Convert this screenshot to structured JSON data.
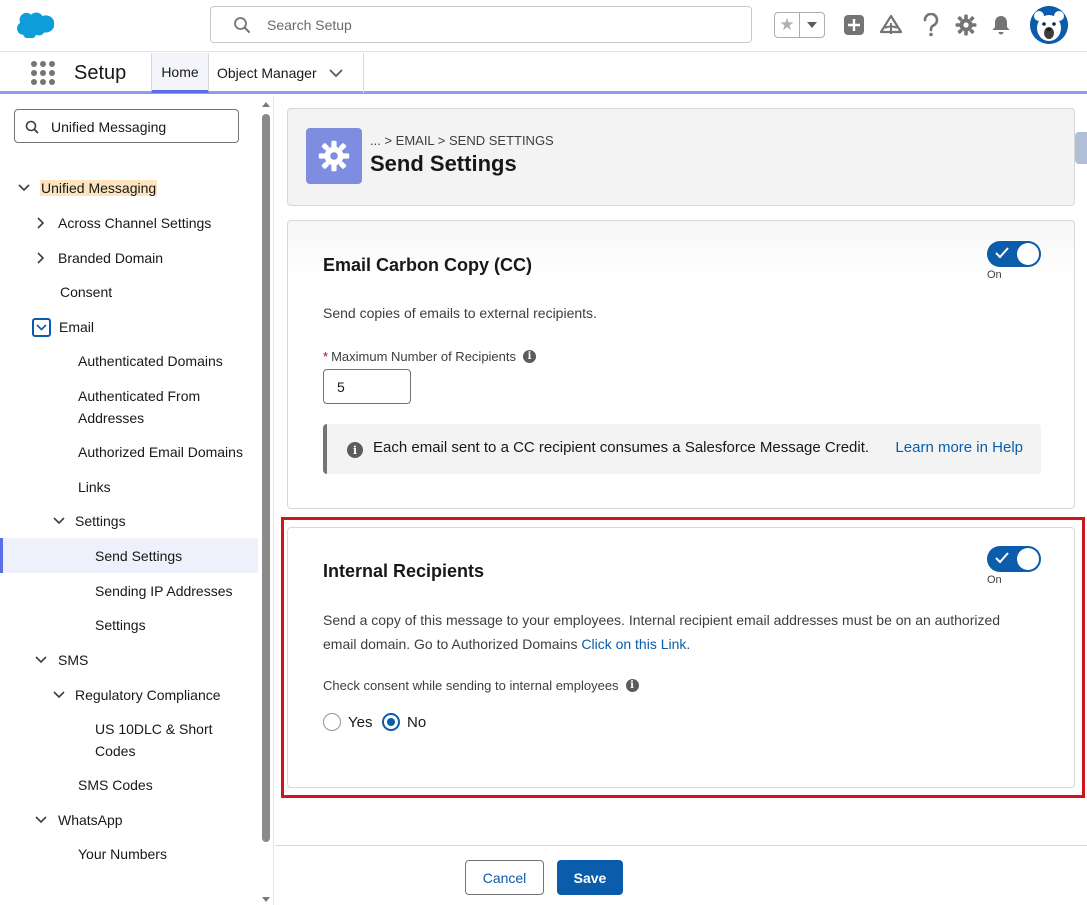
{
  "header": {
    "search_placeholder": "Search Setup",
    "icons": [
      "salesforce-logo",
      "search-icon",
      "star-icon",
      "chevron-down-icon",
      "add-icon",
      "trailhead-icon",
      "help-icon",
      "gear-icon",
      "bell-icon",
      "avatar"
    ]
  },
  "context_bar": {
    "app_name": "Setup",
    "tabs": [
      {
        "label": "Home"
      },
      {
        "label": "Object Manager"
      }
    ]
  },
  "left_nav": {
    "quickfind_value": "Unified Messaging",
    "items": [
      {
        "label": "Unified Messaging"
      },
      {
        "label": "Across Channel Settings"
      },
      {
        "label": "Branded Domain"
      },
      {
        "label": "Consent"
      },
      {
        "label": "Email"
      },
      {
        "label": "Authenticated Domains"
      },
      {
        "label": "Authenticated From"
      },
      {
        "label": "Addresses"
      },
      {
        "label": "Authorized Email Domains"
      },
      {
        "label": "Links"
      },
      {
        "label": "Settings"
      },
      {
        "label": "Send Settings"
      },
      {
        "label": "Sending IP Addresses"
      },
      {
        "label": "Settings"
      },
      {
        "label": "SMS"
      },
      {
        "label": "Regulatory Compliance"
      },
      {
        "label": "US 10DLC & Short"
      },
      {
        "label": "Codes"
      },
      {
        "label": "SMS Codes"
      },
      {
        "label": "WhatsApp"
      },
      {
        "label": "Your Numbers"
      }
    ]
  },
  "page_header": {
    "breadcrumb": "... > EMAIL > SEND SETTINGS",
    "title": "Send Settings"
  },
  "cc_card": {
    "title": "Email Carbon Copy (CC)",
    "toggle_state": "On",
    "description": "Send copies of emails to external recipients.",
    "field_label": "Maximum Number of Recipients",
    "required_marker": "*",
    "field_value": "5",
    "info_glyph": "i",
    "callout_text": "Each email sent to a CC recipient consumes a Salesforce Message Credit.",
    "callout_link": "Learn more in Help"
  },
  "internal_card": {
    "title": "Internal Recipients",
    "toggle_state": "On",
    "description_line1": "Send a copy of this message to your employees. Internal recipient email addresses must be on an authorized",
    "description_line2": "email domain. Go to Authorized Domains ",
    "description_link": "Click on this Link.",
    "consent_label": "Check consent while sending to internal employees",
    "radio_yes": "Yes",
    "radio_no": "No",
    "selected": "No"
  },
  "footer": {
    "cancel_label": "Cancel",
    "save_label": "Save"
  },
  "colors": {
    "brand_blue": "#0b5cab",
    "page_icon": "#7f8de1",
    "highlight": "#fce4bf",
    "annotation_red": "#d1151f"
  }
}
